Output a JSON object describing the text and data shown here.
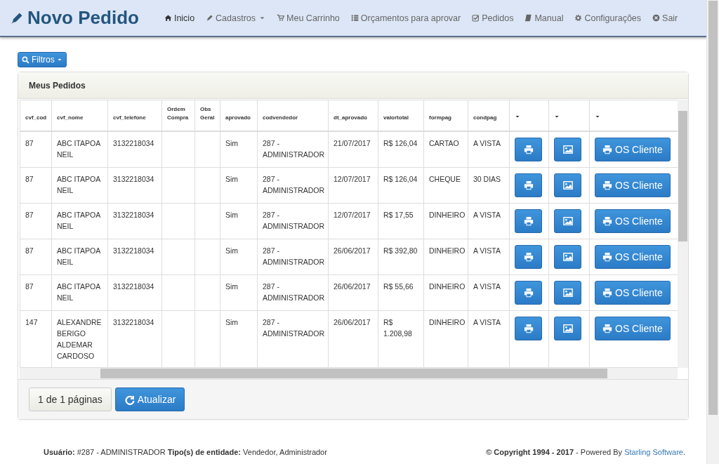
{
  "navbar": {
    "brand": "Novo Pedido",
    "items": [
      {
        "kind": "home",
        "label": "Inicio",
        "selected": true,
        "dropdown": false
      },
      {
        "kind": "pencil",
        "label": "Cadastros",
        "selected": false,
        "dropdown": true
      },
      {
        "kind": "cart",
        "label": "Meu Carrinho",
        "selected": false,
        "dropdown": false
      },
      {
        "kind": "list",
        "label": "Orçamentos para aprovar",
        "selected": false,
        "dropdown": false
      },
      {
        "kind": "check",
        "label": "Pedidos",
        "selected": false,
        "dropdown": false
      },
      {
        "kind": "book",
        "label": "Manual",
        "selected": false,
        "dropdown": false
      },
      {
        "kind": "gear",
        "label": "Configurações",
        "selected": false,
        "dropdown": false
      },
      {
        "kind": "close",
        "label": "Sair",
        "selected": false,
        "dropdown": false
      }
    ]
  },
  "filter_button": "Filtros",
  "panel": {
    "title": "Meus Pedidos",
    "table": {
      "columns": [
        {
          "kind": "text",
          "label": "cvf_cod"
        },
        {
          "kind": "text",
          "label": "cvf_nome"
        },
        {
          "kind": "text",
          "label": "cvf_telefone"
        },
        {
          "kind": "text",
          "label": "Ordem Compra"
        },
        {
          "kind": "text",
          "label": "Obs Geral"
        },
        {
          "kind": "text",
          "label": "aprovado"
        },
        {
          "kind": "text",
          "label": "codvendedor"
        },
        {
          "kind": "text",
          "label": "dt_aprovado"
        },
        {
          "kind": "text",
          "label": "valortotal"
        },
        {
          "kind": "text",
          "label": "formpag"
        },
        {
          "kind": "text",
          "label": "condpag"
        },
        {
          "kind": "caret"
        },
        {
          "kind": "caret"
        },
        {
          "kind": "caret"
        }
      ],
      "rows": [
        {
          "cvf_cod": "87",
          "cvf_nome": "ABC ITAPOA NEIL",
          "cvf_telefone": "3132218034",
          "aprovado": "Sim",
          "codvendedor": "287 - ADMINISTRADOR",
          "dt_aprovado": "21/07/2017",
          "valortotal": "R$ 126,04",
          "formpag": "CARTAO",
          "condpag": "A VISTA",
          "os_button": "OS Cliente"
        },
        {
          "cvf_cod": "87",
          "cvf_nome": "ABC ITAPOA NEIL",
          "cvf_telefone": "3132218034",
          "aprovado": "Sim",
          "codvendedor": "287 - ADMINISTRADOR",
          "dt_aprovado": "12/07/2017",
          "valortotal": "R$ 126,04",
          "formpag": "CHEQUE",
          "condpag": "30 DIAS",
          "os_button": "OS Cliente"
        },
        {
          "cvf_cod": "87",
          "cvf_nome": "ABC ITAPOA NEIL",
          "cvf_telefone": "3132218034",
          "aprovado": "Sim",
          "codvendedor": "287 - ADMINISTRADOR",
          "dt_aprovado": "12/07/2017",
          "valortotal": "R$ 17,55",
          "formpag": "DINHEIRO",
          "condpag": "A VISTA",
          "os_button": "OS Cliente"
        },
        {
          "cvf_cod": "87",
          "cvf_nome": "ABC ITAPOA NEIL",
          "cvf_telefone": "3132218034",
          "aprovado": "Sim",
          "codvendedor": "287 - ADMINISTRADOR",
          "dt_aprovado": "26/06/2017",
          "valortotal": "R$ 392,80",
          "formpag": "DINHEIRO",
          "condpag": "A VISTA",
          "os_button": "OS Cliente"
        },
        {
          "cvf_cod": "87",
          "cvf_nome": "ABC ITAPOA NEIL",
          "cvf_telefone": "3132218034",
          "aprovado": "Sim",
          "codvendedor": "287 - ADMINISTRADOR",
          "dt_aprovado": "26/06/2017",
          "valortotal": "R$ 55,66",
          "formpag": "DINHEIRO",
          "condpag": "A VISTA",
          "os_button": "OS Cliente"
        },
        {
          "cvf_cod": "147",
          "cvf_nome": "ALEXANDRE BERIGO ALDEMAR CARDOSO",
          "cvf_telefone": "3132218034",
          "aprovado": "Sim",
          "codvendedor": "287 - ADMINISTRADOR",
          "dt_aprovado": "26/06/2017",
          "valortotal": "R$ 1.208,98",
          "formpag": "DINHEIRO",
          "condpag": "A VISTA",
          "os_button": "OS Cliente"
        }
      ]
    },
    "pages": "1 de 1 páginas",
    "refresh_button": "Atualizar"
  },
  "footer": {
    "user": "**Usuário:** #287 - ADMINISTRADOR **Tipo(s) de entidade:** Vendedor, Administrador",
    "copyright": "**© Copyright 1994 - 2017** - Powered By ",
    "link": "Starling Software",
    "suffix": "."
  }
}
